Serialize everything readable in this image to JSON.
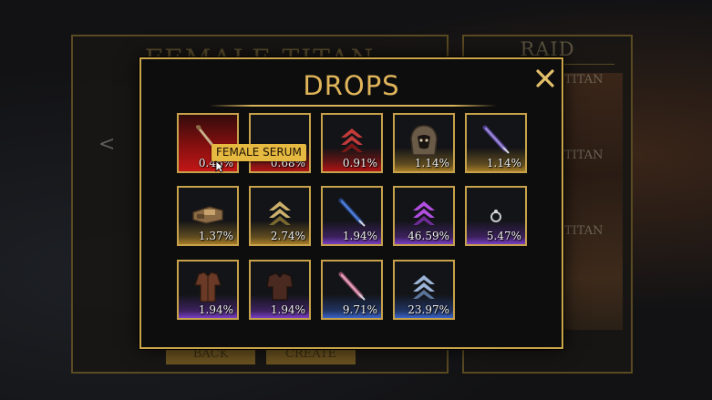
{
  "background": {
    "panel_title": "FEMALE TITAN",
    "back_label": "BACK",
    "create_label": "CREATE",
    "raid_title": "RAID",
    "raid_items": [
      "TITAN",
      "TITAN",
      "TITAN"
    ]
  },
  "modal": {
    "title": "DROPS",
    "close_icon": "close-x-icon"
  },
  "tooltip": {
    "text": "FEMALE SERUM"
  },
  "drops": [
    {
      "name": "female-serum",
      "icon": "serum-vial-icon",
      "rarity": "red",
      "chance": "0.46%"
    },
    {
      "name": "item-2",
      "icon": "unknown-icon",
      "rarity": "red",
      "chance": "0.68%"
    },
    {
      "name": "item-3",
      "icon": "rank-chevron-red-icon",
      "rarity": "red",
      "chance": "0.91%"
    },
    {
      "name": "item-4",
      "icon": "hood-mask-icon",
      "rarity": "gold",
      "chance": "1.14%"
    },
    {
      "name": "item-5",
      "icon": "blade-purple-icon",
      "rarity": "gold",
      "chance": "1.14%"
    },
    {
      "name": "item-6",
      "icon": "gear-device-icon",
      "rarity": "gold",
      "chance": "1.37%"
    },
    {
      "name": "item-7",
      "icon": "rank-chevron-gold-icon",
      "rarity": "gold",
      "chance": "2.74%"
    },
    {
      "name": "item-8",
      "icon": "blade-blue-icon",
      "rarity": "purple",
      "chance": "1.94%"
    },
    {
      "name": "item-9",
      "icon": "rank-chevron-purple-icon",
      "rarity": "purple",
      "chance": "46.59%"
    },
    {
      "name": "item-10",
      "icon": "ring-icon",
      "rarity": "purple",
      "chance": "5.47%"
    },
    {
      "name": "item-11",
      "icon": "jacket-icon",
      "rarity": "purple",
      "chance": "1.94%"
    },
    {
      "name": "item-12",
      "icon": "jacket-dark-icon",
      "rarity": "purple",
      "chance": "1.94%"
    },
    {
      "name": "item-13",
      "icon": "blade-pink-icon",
      "rarity": "blue",
      "chance": "9.71%"
    },
    {
      "name": "item-14",
      "icon": "rank-chevron-blue-icon",
      "rarity": "blue",
      "chance": "23.97%"
    }
  ],
  "colors": {
    "gold_border": "#c7a24b",
    "title": "#e0b55a",
    "tooltip_bg": "#e6b940"
  }
}
